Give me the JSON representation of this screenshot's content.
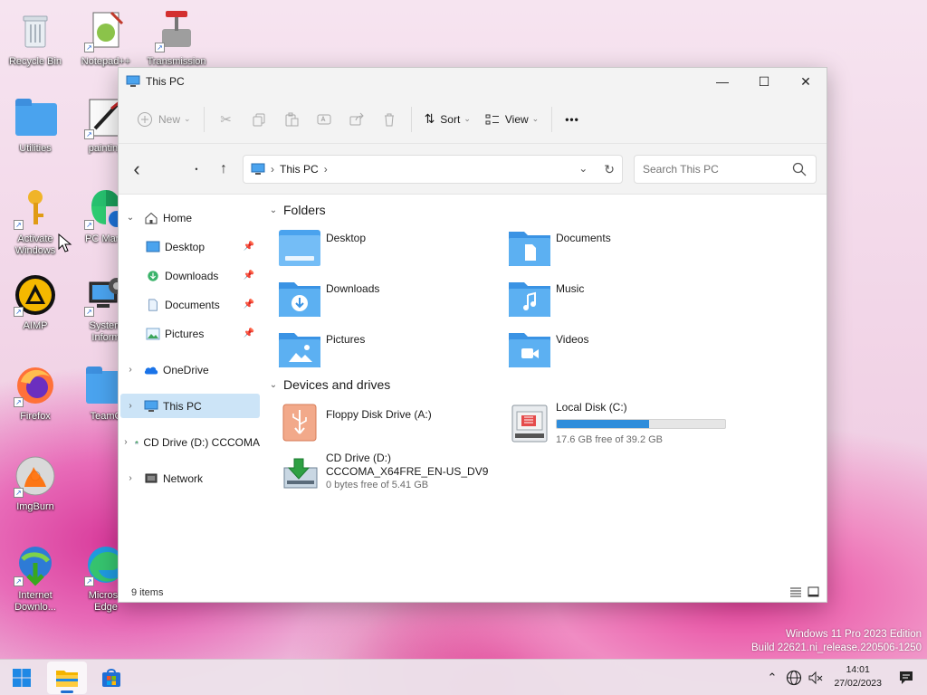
{
  "desktop": {
    "icons": [
      {
        "label": "Recycle Bin"
      },
      {
        "label": "Notepad++"
      },
      {
        "label": "Transmission"
      },
      {
        "label": "Utilities"
      },
      {
        "label": "painting"
      },
      {
        "label": "Activate"
      },
      {
        "label": "Windows"
      },
      {
        "label": "PC Mana"
      },
      {
        "label": "AIMP"
      },
      {
        "label": "System"
      },
      {
        "label": "Inform"
      },
      {
        "label": "Firefox"
      },
      {
        "label": "TeamC"
      },
      {
        "label": "ImgBurn"
      },
      {
        "label": "Internet"
      },
      {
        "label": "Downlo..."
      },
      {
        "label": "Microso"
      },
      {
        "label": "Edge"
      }
    ]
  },
  "window": {
    "title": "This PC",
    "controls": {
      "minimize": "—",
      "maximize": "☐",
      "close": "✕"
    },
    "toolbar": {
      "new_label": "New",
      "sort_label": "Sort",
      "view_label": "View",
      "more_label": "•••"
    },
    "address": {
      "back": "‹",
      "dot": "•",
      "up": "↑",
      "crumb": "This PC",
      "sep1": "›",
      "sep2": "›",
      "dropdown": "⌄",
      "refresh": "↻"
    },
    "search": {
      "placeholder": "Search This PC"
    },
    "nav": {
      "home": "Home",
      "desktop": "Desktop",
      "downloads": "Downloads",
      "documents": "Documents",
      "pictures": "Pictures",
      "onedrive": "OneDrive",
      "thispc": "This PC",
      "cddrive": "CD Drive (D:) CCCOMA",
      "network": "Network"
    },
    "sections": {
      "folders": "Folders",
      "devices": "Devices and drives"
    },
    "folders": [
      {
        "name": "Desktop"
      },
      {
        "name": "Documents"
      },
      {
        "name": "Downloads"
      },
      {
        "name": "Music"
      },
      {
        "name": "Pictures"
      },
      {
        "name": "Videos"
      }
    ],
    "drives": {
      "floppy": {
        "name": "Floppy Disk Drive (A:)"
      },
      "local": {
        "name": "Local Disk (C:)",
        "free": "17.6 GB free of 39.2 GB",
        "used_fraction": 0.55
      },
      "cd": {
        "name": "CD Drive (D:)",
        "label": "CCCOMA_X64FRE_EN-US_DV9",
        "free": "0 bytes free of 5.41 GB"
      }
    },
    "status": {
      "items": "9 items"
    }
  },
  "watermark": {
    "line1": "Windows 11 Pro 2023 Edition",
    "line2": "Build 22621.ni_release.220506-1250"
  },
  "taskbar": {
    "time": "14:01",
    "date": "27/02/2023"
  },
  "colors": {
    "folder_blue": "#4aa3ee",
    "selection": "#cce4f7",
    "progress": "#2f8ddb"
  }
}
